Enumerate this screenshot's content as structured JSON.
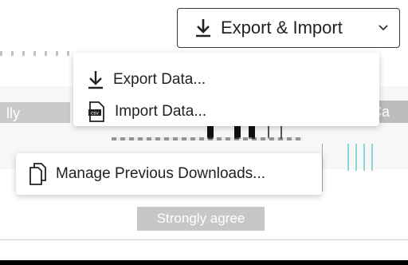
{
  "header": {
    "export_import_label": "Export & Import",
    "export_icon": "download-icon",
    "chevron_icon": "chevron-down-icon"
  },
  "menu": {
    "items": [
      {
        "label": "Export Data...",
        "icon": "download-icon"
      },
      {
        "label": "Import Data...",
        "icon": "csv-file-icon"
      }
    ]
  },
  "popup": {
    "label": "Manage Previous Downloads...",
    "icon": "copy-document-icon"
  },
  "background": {
    "left_fragment": "lly",
    "right_fragment": "Ca",
    "button_label": "Strongly agree"
  },
  "colors": {
    "text": "#222222",
    "border": "#3a3a3a",
    "muted_button": "#c7c7c7"
  }
}
